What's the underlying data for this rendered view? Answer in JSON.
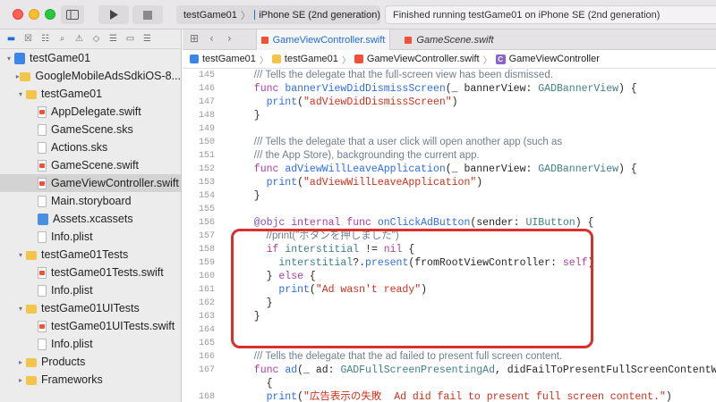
{
  "toolbar": {
    "scheme": "testGame01",
    "device": "iPhone SE (2nd generation)",
    "status": "Finished running testGame01 on iPhone SE (2nd generation)"
  },
  "navigator": {
    "items": [
      {
        "label": "testGame01",
        "indent": 0,
        "disclosure": "▾",
        "icon": "project"
      },
      {
        "label": "GoogleMobileAdsSdkiOS-8...",
        "indent": 1,
        "disclosure": "▸",
        "icon": "folder-y"
      },
      {
        "label": "testGame01",
        "indent": 1,
        "disclosure": "▾",
        "icon": "folder-y"
      },
      {
        "label": "AppDelegate.swift",
        "indent": 2,
        "disclosure": "",
        "icon": "swift"
      },
      {
        "label": "GameScene.sks",
        "indent": 2,
        "disclosure": "",
        "icon": "file"
      },
      {
        "label": "Actions.sks",
        "indent": 2,
        "disclosure": "",
        "icon": "file"
      },
      {
        "label": "GameScene.swift",
        "indent": 2,
        "disclosure": "",
        "icon": "swift"
      },
      {
        "label": "GameViewController.swift",
        "indent": 2,
        "disclosure": "",
        "icon": "swift",
        "selected": true
      },
      {
        "label": "Main.storyboard",
        "indent": 2,
        "disclosure": "",
        "icon": "file"
      },
      {
        "label": "Assets.xcassets",
        "indent": 2,
        "disclosure": "",
        "icon": "assets"
      },
      {
        "label": "Info.plist",
        "indent": 2,
        "disclosure": "",
        "icon": "file"
      },
      {
        "label": "testGame01Tests",
        "indent": 1,
        "disclosure": "▾",
        "icon": "folder-y"
      },
      {
        "label": "testGame01Tests.swift",
        "indent": 2,
        "disclosure": "",
        "icon": "swift"
      },
      {
        "label": "Info.plist",
        "indent": 2,
        "disclosure": "",
        "icon": "file"
      },
      {
        "label": "testGame01UITests",
        "indent": 1,
        "disclosure": "▾",
        "icon": "folder-y"
      },
      {
        "label": "testGame01UITests.swift",
        "indent": 2,
        "disclosure": "",
        "icon": "swift"
      },
      {
        "label": "Info.plist",
        "indent": 2,
        "disclosure": "",
        "icon": "file"
      },
      {
        "label": "Products",
        "indent": 1,
        "disclosure": "▸",
        "icon": "folder-y"
      },
      {
        "label": "Frameworks",
        "indent": 1,
        "disclosure": "▸",
        "icon": "folder-y"
      }
    ]
  },
  "tabs": [
    {
      "label": "GameViewController.swift",
      "active": true
    },
    {
      "label": "GameScene.swift",
      "active": false
    }
  ],
  "jumpbar": {
    "project": "testGame01",
    "group": "testGame01",
    "file": "GameViewController.swift",
    "symbol": "GameViewController"
  },
  "code": {
    "lines": [
      {
        "n": "145",
        "indent": 2,
        "tokens": [
          {
            "c": "cmt",
            "t": "/// Tells the delegate that the full-screen view has been dismissed."
          }
        ]
      },
      {
        "n": "146",
        "indent": 2,
        "tokens": [
          {
            "c": "kw",
            "t": "func "
          },
          {
            "c": "fn",
            "t": "bannerViewDidDismissScreen"
          },
          {
            "c": "",
            "t": "(_ bannerView: "
          },
          {
            "c": "ty",
            "t": "GADBannerView"
          },
          {
            "c": "",
            "t": ") {"
          }
        ]
      },
      {
        "n": "147",
        "indent": 4,
        "tokens": [
          {
            "c": "fn",
            "t": "print"
          },
          {
            "c": "",
            "t": "("
          },
          {
            "c": "st",
            "t": "\"adViewDidDismissScreen\""
          },
          {
            "c": "",
            "t": ")"
          }
        ]
      },
      {
        "n": "148",
        "indent": 2,
        "tokens": [
          {
            "c": "",
            "t": "}"
          }
        ]
      },
      {
        "n": "149",
        "indent": 0,
        "tokens": []
      },
      {
        "n": "150",
        "indent": 2,
        "tokens": [
          {
            "c": "cmt",
            "t": "/// Tells the delegate that a user click will open another app (such as"
          }
        ]
      },
      {
        "n": "151",
        "indent": 2,
        "tokens": [
          {
            "c": "cmt",
            "t": "/// the App Store), backgrounding the current app."
          }
        ]
      },
      {
        "n": "152",
        "indent": 2,
        "tokens": [
          {
            "c": "kw",
            "t": "func "
          },
          {
            "c": "fn",
            "t": "adViewWillLeaveApplication"
          },
          {
            "c": "",
            "t": "(_ bannerView: "
          },
          {
            "c": "ty",
            "t": "GADBannerView"
          },
          {
            "c": "",
            "t": ") {"
          }
        ]
      },
      {
        "n": "153",
        "indent": 4,
        "tokens": [
          {
            "c": "fn",
            "t": "print"
          },
          {
            "c": "",
            "t": "("
          },
          {
            "c": "st",
            "t": "\"adViewWillLeaveApplication\""
          },
          {
            "c": "",
            "t": ")"
          }
        ]
      },
      {
        "n": "154",
        "indent": 2,
        "tokens": [
          {
            "c": "",
            "t": "}"
          }
        ]
      },
      {
        "n": "155",
        "indent": 0,
        "tokens": []
      },
      {
        "n": "156",
        "indent": 2,
        "tokens": [
          {
            "c": "at",
            "t": "@objc "
          },
          {
            "c": "kw",
            "t": "internal func "
          },
          {
            "c": "fn",
            "t": "onClickAdButton"
          },
          {
            "c": "",
            "t": "(sender: "
          },
          {
            "c": "ty",
            "t": "UIButton"
          },
          {
            "c": "",
            "t": ") {"
          }
        ]
      },
      {
        "n": "157",
        "indent": 4,
        "tokens": [
          {
            "c": "cmt",
            "t": "//print(\"ボタンを押しました\")"
          }
        ]
      },
      {
        "n": "158",
        "indent": 4,
        "tokens": [
          {
            "c": "kw",
            "t": "if "
          },
          {
            "c": "ty",
            "t": "interstitial"
          },
          {
            "c": "",
            "t": " != "
          },
          {
            "c": "kw",
            "t": "nil"
          },
          {
            "c": "",
            "t": " {"
          }
        ]
      },
      {
        "n": "159",
        "indent": 6,
        "tokens": [
          {
            "c": "ty",
            "t": "interstitial"
          },
          {
            "c": "",
            "t": "?."
          },
          {
            "c": "fn",
            "t": "present"
          },
          {
            "c": "",
            "t": "(fromRootViewController: "
          },
          {
            "c": "kw",
            "t": "self"
          },
          {
            "c": "",
            "t": ")"
          }
        ]
      },
      {
        "n": "160",
        "indent": 4,
        "tokens": [
          {
            "c": "",
            "t": "} "
          },
          {
            "c": "kw",
            "t": "else"
          },
          {
            "c": "",
            "t": " {"
          }
        ]
      },
      {
        "n": "161",
        "indent": 6,
        "tokens": [
          {
            "c": "fn",
            "t": "print"
          },
          {
            "c": "",
            "t": "("
          },
          {
            "c": "st",
            "t": "\"Ad wasn't ready\""
          },
          {
            "c": "",
            "t": ")"
          }
        ]
      },
      {
        "n": "162",
        "indent": 4,
        "tokens": [
          {
            "c": "",
            "t": "}"
          }
        ]
      },
      {
        "n": "163",
        "indent": 2,
        "tokens": [
          {
            "c": "",
            "t": "}"
          }
        ]
      },
      {
        "n": "164",
        "indent": 0,
        "tokens": []
      },
      {
        "n": "165",
        "indent": 0,
        "tokens": []
      },
      {
        "n": "166",
        "indent": 2,
        "tokens": [
          {
            "c": "cmt",
            "t": "/// Tells the delegate that the ad failed to present full screen content."
          }
        ]
      },
      {
        "n": "167",
        "indent": 2,
        "tokens": [
          {
            "c": "kw",
            "t": "func "
          },
          {
            "c": "fn",
            "t": "ad"
          },
          {
            "c": "",
            "t": "(_ ad: "
          },
          {
            "c": "ty",
            "t": "GADFullScreenPresentingAd"
          },
          {
            "c": "",
            "t": ", didFailToPresentFullScreenContentWithError er"
          }
        ]
      },
      {
        "n": "",
        "indent": 4,
        "tokens": [
          {
            "c": "",
            "t": "{"
          }
        ]
      },
      {
        "n": "168",
        "indent": 4,
        "tokens": [
          {
            "c": "fn",
            "t": "print"
          },
          {
            "c": "",
            "t": "("
          },
          {
            "c": "st",
            "t": "\"広告表示の失敗  Ad did fail to present full screen content.\""
          },
          {
            "c": "",
            "t": ")"
          }
        ]
      },
      {
        "n": "169",
        "indent": 2,
        "tokens": [
          {
            "c": "",
            "t": "}"
          }
        ]
      }
    ]
  }
}
